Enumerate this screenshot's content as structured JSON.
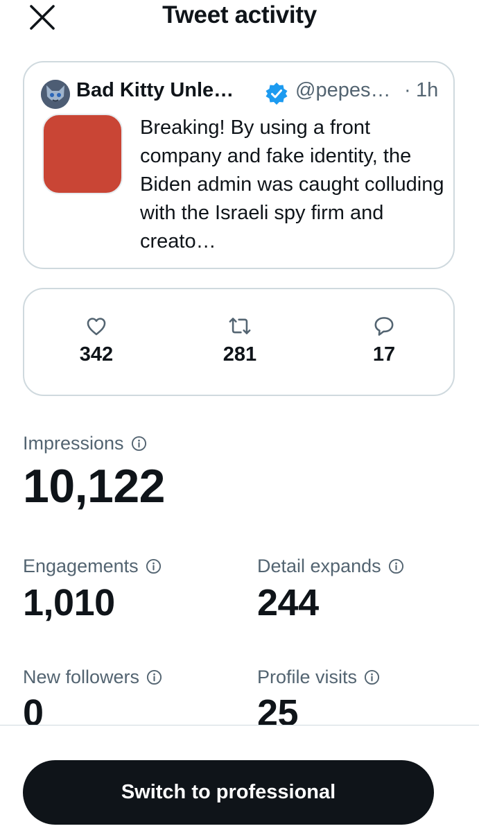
{
  "header": {
    "title": "Tweet activity"
  },
  "tweet": {
    "author": "Bad Kitty Unle…",
    "handle": "@pepes…",
    "separator": "·",
    "time": "1h",
    "text": "Breaking! By using a front company and fake identity, the Biden admin was caught colluding with the Israeli spy firm and creato…",
    "thumbnail_color": "#c94535",
    "verified_color": "#1d9bf0"
  },
  "engagement_counts": {
    "likes": "342",
    "retweets": "281",
    "replies": "17"
  },
  "metrics": {
    "impressions": {
      "label": "Impressions",
      "value": "10,122"
    },
    "engagements": {
      "label": "Engagements",
      "value": "1,010"
    },
    "detail_expands": {
      "label": "Detail expands",
      "value": "244"
    },
    "new_followers": {
      "label": "New followers",
      "value": "0"
    },
    "profile_visits": {
      "label": "Profile visits",
      "value": "25"
    }
  },
  "cta": {
    "label": "Switch to professional"
  }
}
